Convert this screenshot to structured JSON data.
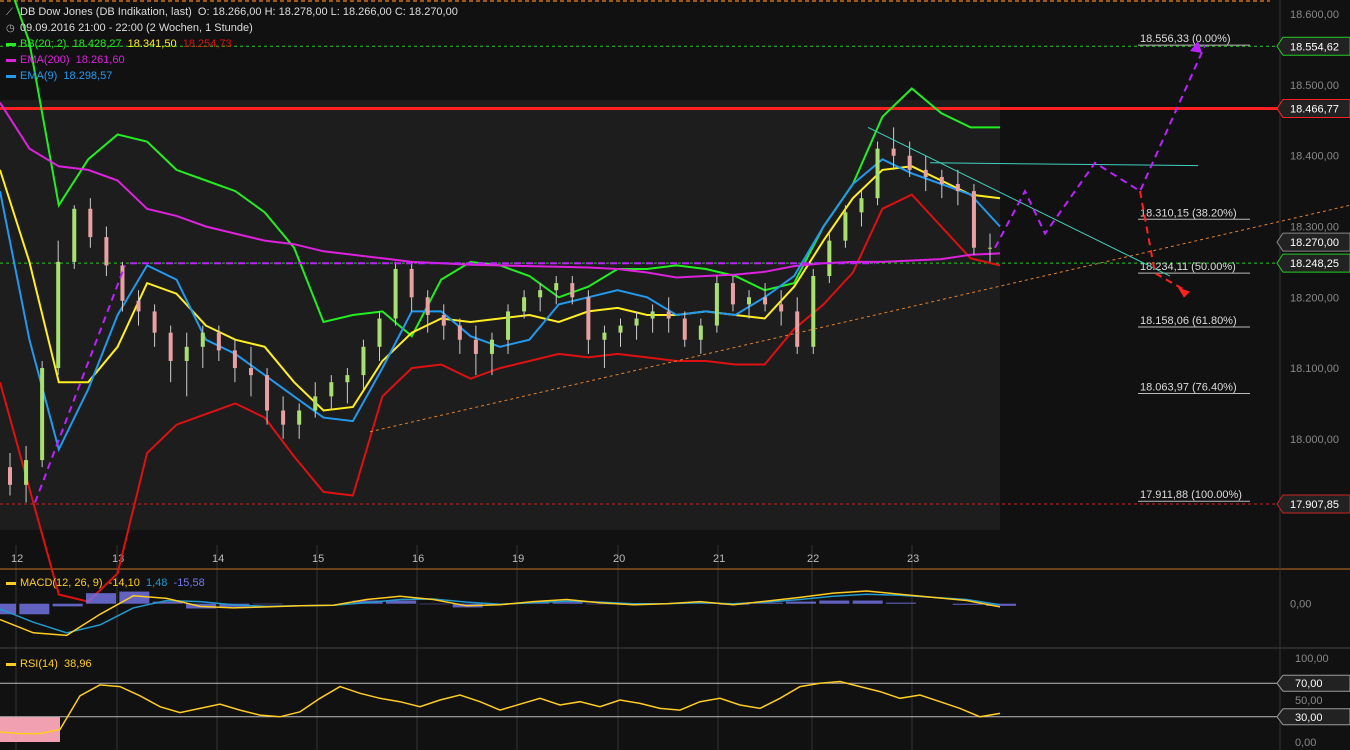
{
  "header": {
    "instrument": "DB Dow Jones (DB Indikation, last)",
    "ohlc": "O: 18.266,00  H: 18.278,00  L: 18.266,00  C: 18.270,00",
    "period": "09.09.2016 21:00 - 22:00 (2 Wochen, 1 Stunde)",
    "bb": {
      "label": "BB(20; 2)",
      "v1": "18.428,27",
      "v2": "18.341,50",
      "v3": "18.254,73"
    },
    "ema200": {
      "label": "EMA(200)",
      "value": "18.261,60"
    },
    "ema9": {
      "label": "EMA(9)",
      "value": "18.298,57"
    }
  },
  "colors": {
    "background": "#111111",
    "panel": "#1e1e1e",
    "bb_upper": "#22ee22",
    "bb_mid": "#ffee22",
    "bb_lower": "#dd1111",
    "ema200": "#dd22dd",
    "ema9": "#2299ee",
    "resistance": "#ff2020",
    "scenario": "#bb22ff",
    "fib": "#ffffff",
    "up_candle": "#a8e070",
    "down_candle": "#e8a0a0",
    "macd_line": "#ffcc22",
    "macd_signal": "#2299cc",
    "macd_hist": "#7777ee",
    "rsi": "#ffcc22"
  },
  "chart_data": {
    "type": "line",
    "x_labels": [
      "12",
      "13",
      "14",
      "15",
      "16",
      "19",
      "20",
      "21",
      "22",
      "23"
    ],
    "price_axis": {
      "ylim": [
        17850,
        18620
      ],
      "ticks": [
        "18.600,00",
        "18.500,00",
        "18.400,00",
        "18.300,00",
        "18.200,00",
        "18.100,00",
        "18.000,00"
      ],
      "tick_values": [
        18600,
        18500,
        18400,
        18300,
        18200,
        18100,
        18000
      ]
    },
    "right_labels": [
      {
        "text": "18.554,62",
        "value": 18554.62,
        "color": "#22cc22"
      },
      {
        "text": "18.466,77",
        "value": 18466.77,
        "color": "#ff2020"
      },
      {
        "text": "18.270,00",
        "value": 18278,
        "color": "#888888"
      },
      {
        "text": "18.248,25",
        "value": 18248.25,
        "color": "#22cc22"
      },
      {
        "text": "17.907,85",
        "value": 17907.85,
        "color": "#cc2222"
      }
    ],
    "fib_levels": [
      {
        "text": "18.556,33 (0.00%)",
        "value": 18556.33
      },
      {
        "text": "18.310,15 (38.20%)",
        "value": 18310.15
      },
      {
        "text": "18.234,11 (50.00%)",
        "value": 18234.11
      },
      {
        "text": "18.158,06 (61.80%)",
        "value": 18158.06
      },
      {
        "text": "18.063,97 (76.40%)",
        "value": 18063.97
      },
      {
        "text": "17.911,88 (100.00%)",
        "value": 17911.88
      }
    ],
    "horizontal_lines": [
      {
        "value": 18466.77,
        "style": "solid",
        "color": "#ff2020"
      },
      {
        "value": 18554.62,
        "style": "dashed",
        "color": "#22cc22"
      },
      {
        "value": 18248.25,
        "style": "dashed",
        "color": "#22cc22"
      },
      {
        "value": 17907.85,
        "style": "dashed",
        "color": "#cc2222"
      }
    ],
    "series": [
      {
        "name": "BB(20; 2)",
        "key": "upper",
        "values": [
          18680,
          18560,
          18330,
          18395,
          18430,
          18420,
          18380,
          18365,
          18350,
          18320,
          18270,
          18165,
          18175,
          18180,
          18145,
          18225,
          18250,
          18245,
          18230,
          18200,
          18215,
          18240,
          18240,
          18245,
          18240,
          18230,
          18210,
          18220,
          18300,
          18360,
          18455,
          18495,
          18460,
          18440,
          18440
        ]
      },
      {
        "name": "BB mid",
        "key": "mid",
        "values": [
          18380,
          18250,
          18080,
          18080,
          18130,
          18220,
          18205,
          18160,
          18140,
          18130,
          18080,
          18040,
          18045,
          18110,
          18150,
          18170,
          18165,
          18170,
          18175,
          18165,
          18180,
          18185,
          18175,
          18175,
          18180,
          18175,
          18170,
          18215,
          18280,
          18340,
          18380,
          18385,
          18365,
          18345,
          18340
        ]
      },
      {
        "name": "BB lower",
        "key": "lower",
        "values": [
          18080,
          17930,
          17780,
          17770,
          17810,
          17980,
          18020,
          18035,
          18050,
          18030,
          17975,
          17925,
          17920,
          18060,
          18100,
          18105,
          18085,
          18100,
          18110,
          18120,
          18115,
          18120,
          18115,
          18110,
          18110,
          18105,
          18105,
          18155,
          18190,
          18235,
          18325,
          18345,
          18300,
          18255,
          18245
        ]
      },
      {
        "name": "EMA(200)",
        "key": "ema200",
        "values": [
          18475,
          18410,
          18385,
          18380,
          18365,
          18325,
          18315,
          18300,
          18290,
          18280,
          18275,
          18265,
          18260,
          18255,
          18250,
          18248,
          18246,
          18245,
          18244,
          18243,
          18242,
          18240,
          18235,
          18228,
          18230,
          18232,
          18236,
          18244,
          18248,
          18250,
          18250,
          18252,
          18254,
          18260,
          18262
        ]
      },
      {
        "name": "EMA(9)",
        "key": "ema9",
        "values": [
          18350,
          18140,
          17985,
          18070,
          18175,
          18245,
          18225,
          18140,
          18120,
          18090,
          18060,
          18030,
          18025,
          18100,
          18180,
          18180,
          18145,
          18130,
          18140,
          18190,
          18200,
          18210,
          18200,
          18175,
          18180,
          18175,
          18200,
          18230,
          18300,
          18360,
          18395,
          18375,
          18360,
          18345,
          18300
        ]
      }
    ],
    "candles_ohlc": [
      [
        17960,
        17980,
        17920,
        17935
      ],
      [
        17935,
        17990,
        17910,
        17970
      ],
      [
        17970,
        18110,
        17960,
        18100
      ],
      [
        18100,
        18280,
        18090,
        18250
      ],
      [
        18250,
        18330,
        18240,
        18325
      ],
      [
        18325,
        18340,
        18270,
        18285
      ],
      [
        18285,
        18300,
        18230,
        18245
      ],
      [
        18245,
        18250,
        18180,
        18195
      ],
      [
        18195,
        18210,
        18160,
        18180
      ],
      [
        18180,
        18190,
        18130,
        18150
      ],
      [
        18150,
        18160,
        18080,
        18110
      ],
      [
        18110,
        18150,
        18060,
        18130
      ],
      [
        18130,
        18160,
        18100,
        18150
      ],
      [
        18150,
        18160,
        18110,
        18125
      ],
      [
        18125,
        18140,
        18080,
        18100
      ],
      [
        18100,
        18130,
        18060,
        18090
      ],
      [
        18090,
        18100,
        18020,
        18040
      ],
      [
        18040,
        18060,
        18000,
        18020
      ],
      [
        18020,
        18050,
        18000,
        18040
      ],
      [
        18040,
        18080,
        18030,
        18060
      ],
      [
        18060,
        18090,
        18040,
        18080
      ],
      [
        18080,
        18100,
        18050,
        18090
      ],
      [
        18090,
        18140,
        18070,
        18130
      ],
      [
        18130,
        18180,
        18110,
        18170
      ],
      [
        18170,
        18250,
        18160,
        18240
      ],
      [
        18240,
        18250,
        18180,
        18200
      ],
      [
        18200,
        18210,
        18150,
        18175
      ],
      [
        18175,
        18190,
        18140,
        18160
      ],
      [
        18160,
        18170,
        18120,
        18140
      ],
      [
        18140,
        18160,
        18090,
        18120
      ],
      [
        18120,
        18150,
        18090,
        18140
      ],
      [
        18140,
        18190,
        18120,
        18180
      ],
      [
        18180,
        18210,
        18170,
        18200
      ],
      [
        18200,
        18220,
        18180,
        18210
      ],
      [
        18210,
        18230,
        18190,
        18220
      ],
      [
        18220,
        18230,
        18190,
        18200
      ],
      [
        18200,
        18210,
        18120,
        18140
      ],
      [
        18140,
        18160,
        18100,
        18150
      ],
      [
        18150,
        18170,
        18130,
        18160
      ],
      [
        18160,
        18180,
        18140,
        18170
      ],
      [
        18170,
        18190,
        18150,
        18180
      ],
      [
        18180,
        18200,
        18150,
        18170
      ],
      [
        18170,
        18180,
        18130,
        18140
      ],
      [
        18140,
        18170,
        18120,
        18160
      ],
      [
        18160,
        18230,
        18150,
        18220
      ],
      [
        18220,
        18230,
        18180,
        18190
      ],
      [
        18190,
        18210,
        18170,
        18200
      ],
      [
        18200,
        18220,
        18180,
        18190
      ],
      [
        18190,
        18210,
        18160,
        18180
      ],
      [
        18180,
        18200,
        18120,
        18130
      ],
      [
        18130,
        18240,
        18120,
        18230
      ],
      [
        18230,
        18290,
        18220,
        18280
      ],
      [
        18280,
        18330,
        18270,
        18320
      ],
      [
        18320,
        18350,
        18300,
        18340
      ],
      [
        18340,
        18420,
        18330,
        18410
      ],
      [
        18410,
        18440,
        18380,
        18400
      ],
      [
        18400,
        18420,
        18370,
        18380
      ],
      [
        18380,
        18400,
        18350,
        18370
      ],
      [
        18370,
        18380,
        18340,
        18360
      ],
      [
        18360,
        18380,
        18330,
        18350
      ],
      [
        18350,
        18360,
        18260,
        18270
      ],
      [
        18270,
        18290,
        18250,
        18270
      ]
    ],
    "macd": {
      "label": "MACD(12, 26, 9)",
      "values": [
        "-14,10",
        "1,48",
        "-15,58"
      ],
      "ylim": [
        -80,
        60
      ],
      "tick": "0,00",
      "line": [
        -30,
        -55,
        -60,
        -20,
        15,
        10,
        -5,
        -8,
        -6,
        -4,
        -3,
        8,
        14,
        8,
        -4,
        -2,
        4,
        8,
        2,
        -2,
        0,
        4,
        -2,
        5,
        12,
        20,
        24,
        18,
        12,
        6,
        -6
      ],
      "signal": [
        -10,
        -35,
        -55,
        -40,
        -8,
        6,
        4,
        -2,
        -5,
        -4,
        -3,
        2,
        8,
        9,
        3,
        -1,
        2,
        5,
        3,
        0,
        0,
        2,
        0,
        3,
        8,
        14,
        18,
        16,
        12,
        8,
        -2
      ],
      "hist": [
        -20,
        -20,
        -5,
        20,
        23,
        4,
        -9,
        -6,
        -1,
        0,
        0,
        6,
        6,
        -1,
        -7,
        -1,
        2,
        3,
        -1,
        -2,
        0,
        2,
        -2,
        2,
        4,
        6,
        6,
        2,
        0,
        -2,
        -4
      ]
    },
    "rsi": {
      "label": "RSI(14)",
      "value": "38,96",
      "ylim": [
        0,
        100
      ],
      "ticks": [
        "100,00",
        "70,00",
        "50,00",
        "30,00",
        "0,00"
      ],
      "tick_values": [
        100,
        70,
        50,
        30,
        0
      ],
      "values": [
        12,
        10,
        10,
        15,
        55,
        68,
        66,
        55,
        42,
        35,
        40,
        45,
        38,
        32,
        30,
        36,
        52,
        66,
        58,
        52,
        48,
        42,
        50,
        56,
        48,
        38,
        45,
        52,
        44,
        48,
        42,
        50,
        46,
        40,
        38,
        48,
        52,
        44,
        40,
        52,
        66,
        70,
        72,
        66,
        60,
        52,
        56,
        48,
        40,
        30,
        34
      ]
    }
  }
}
